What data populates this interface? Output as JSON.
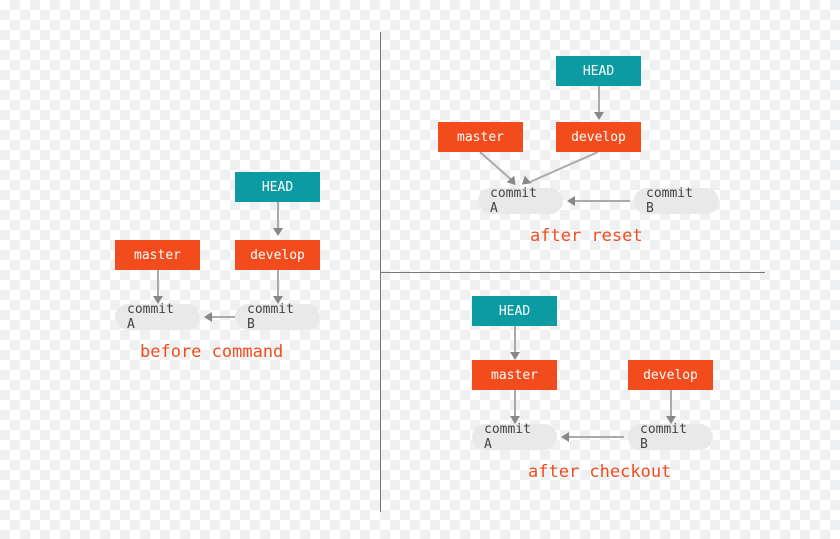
{
  "labels": {
    "head": "HEAD",
    "master": "master",
    "develop": "develop",
    "commitA": "commit A",
    "commitB": "commit B"
  },
  "captions": {
    "before": "before command",
    "afterReset": "after reset",
    "afterCheckout": "after checkout"
  }
}
